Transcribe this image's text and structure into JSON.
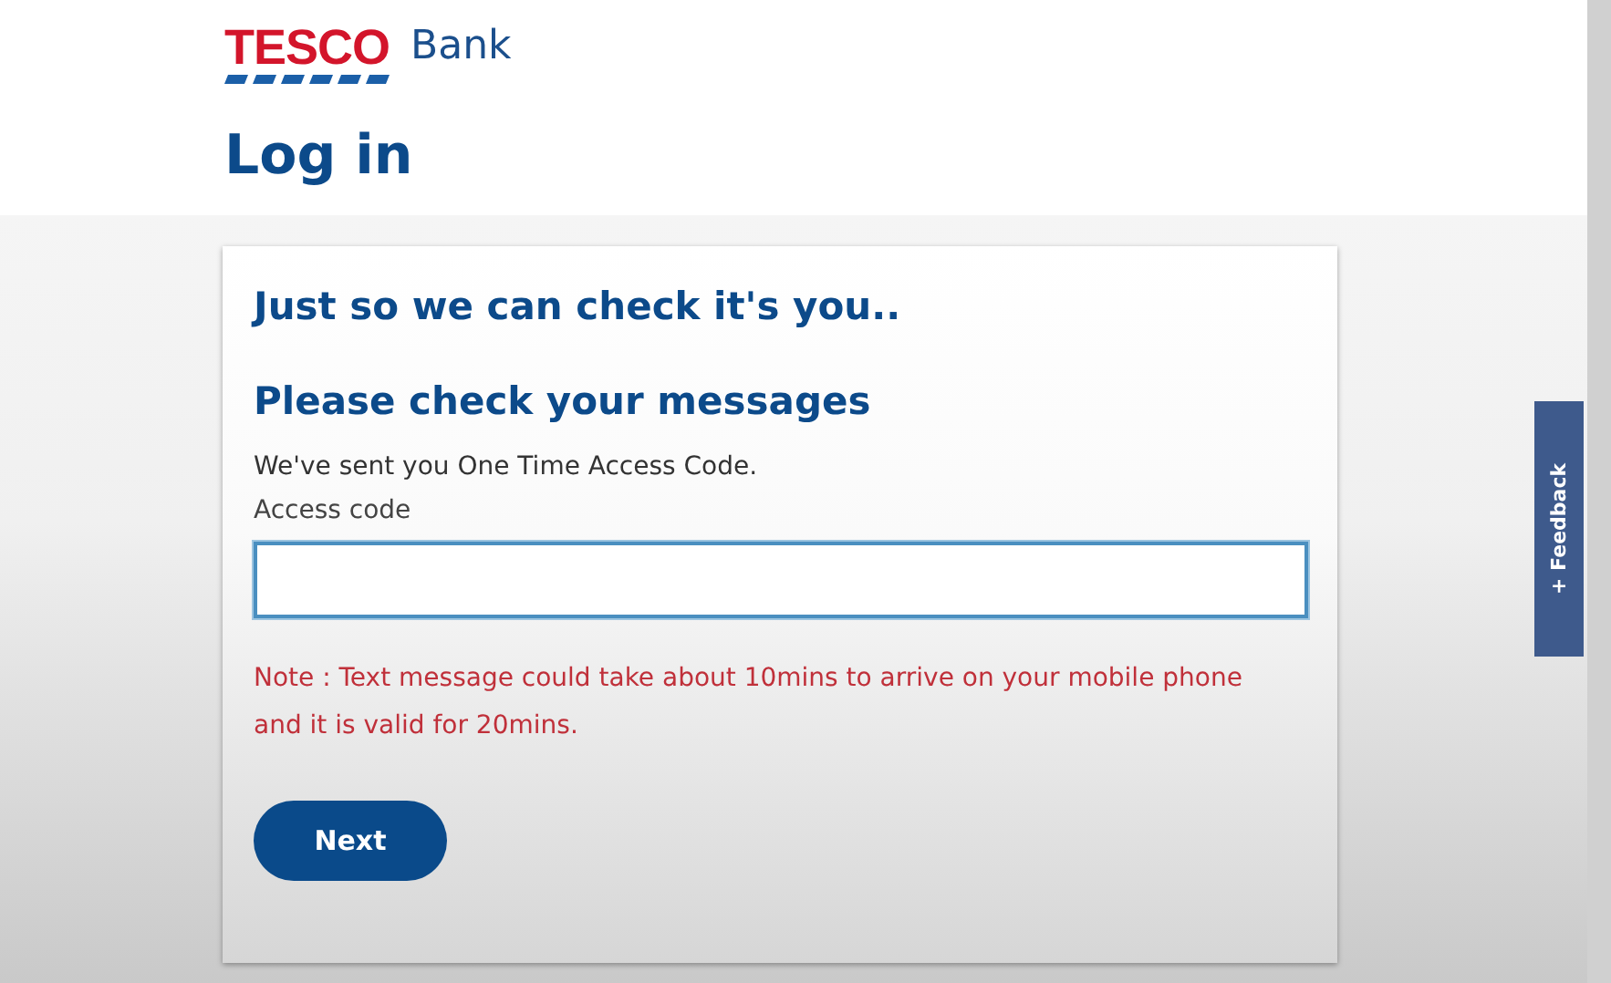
{
  "logo": {
    "brand": "TESCO",
    "suffix": "Bank"
  },
  "page_title": "Log in",
  "card": {
    "heading": "Just so we can check it's you..",
    "subheading": "Please check your messages",
    "message": "We've sent you One Time Access Code.",
    "field": {
      "label": "Access code",
      "focused": true
    },
    "note": "Note : Text message could take about 10mins to arrive on your mobile phone and it is valid for 20mins.",
    "button": "Next"
  },
  "feedback_tab": "+ Feedback"
}
